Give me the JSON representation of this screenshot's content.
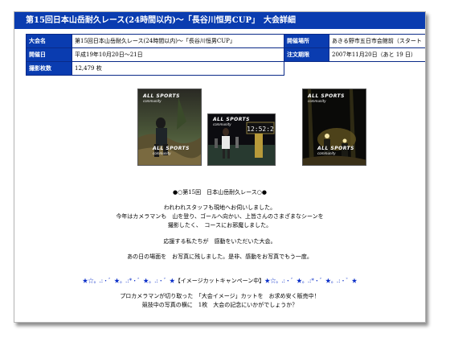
{
  "title": "第15回日本山岳耐久レース(24時間以内)～「長谷川恒男CUP」　大会詳細",
  "info": {
    "event_label": "大会名",
    "event_value": "第15回日本山岳耐久レース(24時間以内)～「長谷川恒男CUP」",
    "venue_label": "開催場所",
    "venue_value": "あきる野市五日市会館前（スタート",
    "date_label": "開催日",
    "date_value": "平成19年10月20日～21日",
    "order_label": "注文期限",
    "order_value": "2007年11月20日（あと 19 日）",
    "photos_label": "撮影枚数",
    "photos_value": "12,479 枚"
  },
  "photos": [
    {
      "watermark": "ALL SPORTS",
      "sub": "community",
      "colors": [
        "#2a2a24",
        "#4d5a3a",
        "#6e7a58"
      ]
    },
    {
      "watermark": "ALL SPORTS",
      "sub": "community",
      "colors": [
        "#0c0c10",
        "#283a30",
        "#8a7a3c"
      ]
    },
    {
      "watermark": "ALL SPORTS",
      "sub": "community",
      "colors": [
        "#0a0a08",
        "#2e2a14",
        "#6a5a22"
      ]
    }
  ],
  "clock_text": "12:52:2",
  "intro": {
    "heading": "●○第15回　日本山岳耐久レース○●",
    "p1_l1": "われわれスタッフも現地へお伺いしました。",
    "p1_l2": "今年はカメラマンも　山を登り、ゴールへ向かい、上皆さんのさまざまなシーンを",
    "p1_l3": "撮影したく、　コースにお邪魔しました。",
    "p2": "応援する私たちが　感動をいただいた大会。",
    "p3": "あの日の場面を　お写真に残しました。是非、感動をお写真でもう一度。"
  },
  "campaign": {
    "stars_left": "★☆。.:・゛★。.:*・゛★。.:・゛★",
    "label": "【イメージカットキャンペーン中】",
    "stars_right": "★☆。.:・゛★。.:*・゛★。.:・゛★"
  },
  "closing": {
    "l1": "プロカメラマンが切り取った　「大会イメージ」カットを　お求め安く販売中！",
    "l2": "競技中の写真の横に　1枚　大会の記念にいかがでしょうか？"
  },
  "colors": {
    "header_blue": "#0a3cb0",
    "accent_blue": "#0a2ec8"
  }
}
